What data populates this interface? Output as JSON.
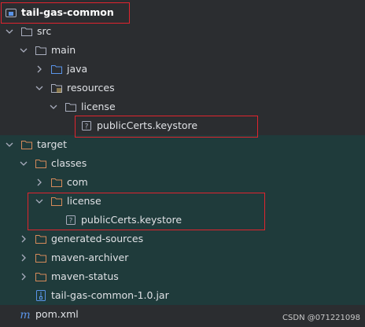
{
  "tree": {
    "root": "tail-gas-common",
    "src": "src",
    "main": "main",
    "java": "java",
    "resources": "resources",
    "license1": "license",
    "keystore1": "publicCerts.keystore",
    "target": "target",
    "classes": "classes",
    "com": "com",
    "license2": "license",
    "keystore2": "publicCerts.keystore",
    "generated_sources": "generated-sources",
    "maven_archiver": "maven-archiver",
    "maven_status": "maven-status",
    "jar": "tail-gas-common-1.0.jar",
    "pom": "pom.xml"
  },
  "watermark": "CSDN @071221098",
  "colors": {
    "background": "#2b2d30",
    "excluded_background": "#1f3b3b",
    "highlight_border": "#e0242e",
    "folder_outline": "#a8adbd",
    "excluded_folder": "#d58a5a",
    "source_folder": "#5a94e8"
  }
}
